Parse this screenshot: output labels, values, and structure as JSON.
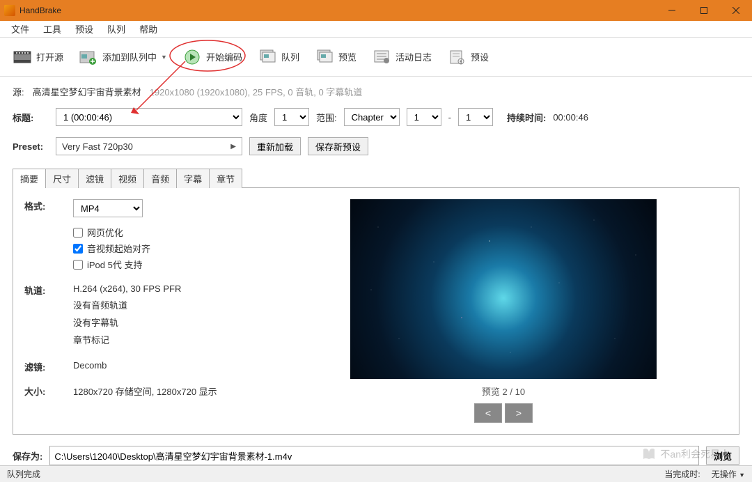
{
  "window": {
    "title": "HandBrake"
  },
  "menu": {
    "file": "文件",
    "tools": "工具",
    "presets": "预设",
    "queue": "队列",
    "help": "帮助"
  },
  "toolbar": {
    "open_source": "打开源",
    "add_to_queue": "添加到队列中",
    "start_encode": "开始编码",
    "queue": "队列",
    "preview": "预览",
    "activity_log": "活动日志",
    "presets": "预设"
  },
  "source": {
    "label": "源:",
    "name": "高清星空梦幻宇宙背景素材",
    "meta": "1920x1080 (1920x1080), 25 FPS, 0 音轨, 0 字幕轨道"
  },
  "title": {
    "label": "标题:",
    "value": "1 (00:00:46)",
    "angle_label": "角度",
    "angle_value": "1",
    "range_label": "范围:",
    "range_type": "Chapters",
    "range_from": "1",
    "range_dash": "-",
    "range_to": "1",
    "duration_label": "持续时间:",
    "duration_value": "00:00:46"
  },
  "preset": {
    "label": "Preset:",
    "value": "Very Fast 720p30",
    "reload": "重新加载",
    "save_new": "保存新预设"
  },
  "tabs": [
    "摘要",
    "尺寸",
    "滤镜",
    "视频",
    "音频",
    "字幕",
    "章节"
  ],
  "summary": {
    "format_label": "格式:",
    "format_value": "MP4",
    "chk_web": "网页优化",
    "chk_avstart": "音视频起始对齐",
    "chk_ipod": "iPod 5代 支持",
    "tracks_label": "轨道:",
    "tracks_codec": "H.264 (x264), 30 FPS PFR",
    "tracks_noaudio": "没有音频轨道",
    "tracks_nosub": "没有字幕轨",
    "tracks_chapters": "章节标记",
    "filters_label": "滤镜:",
    "filters_value": "Decomb",
    "size_label": "大小:",
    "size_value": "1280x720 存储空间, 1280x720 显示"
  },
  "preview": {
    "label": "预览 2 / 10",
    "prev": "<",
    "next": ">"
  },
  "save": {
    "label": "保存为:",
    "path": "C:\\Users\\12040\\Desktop\\高清星空梦幻宇宙背景素材-1.m4v",
    "browse": "浏览"
  },
  "status": {
    "left": "队列完成",
    "done_label": "当完成时:",
    "done_value": "无操作"
  },
  "watermark": "不an利会死星人"
}
